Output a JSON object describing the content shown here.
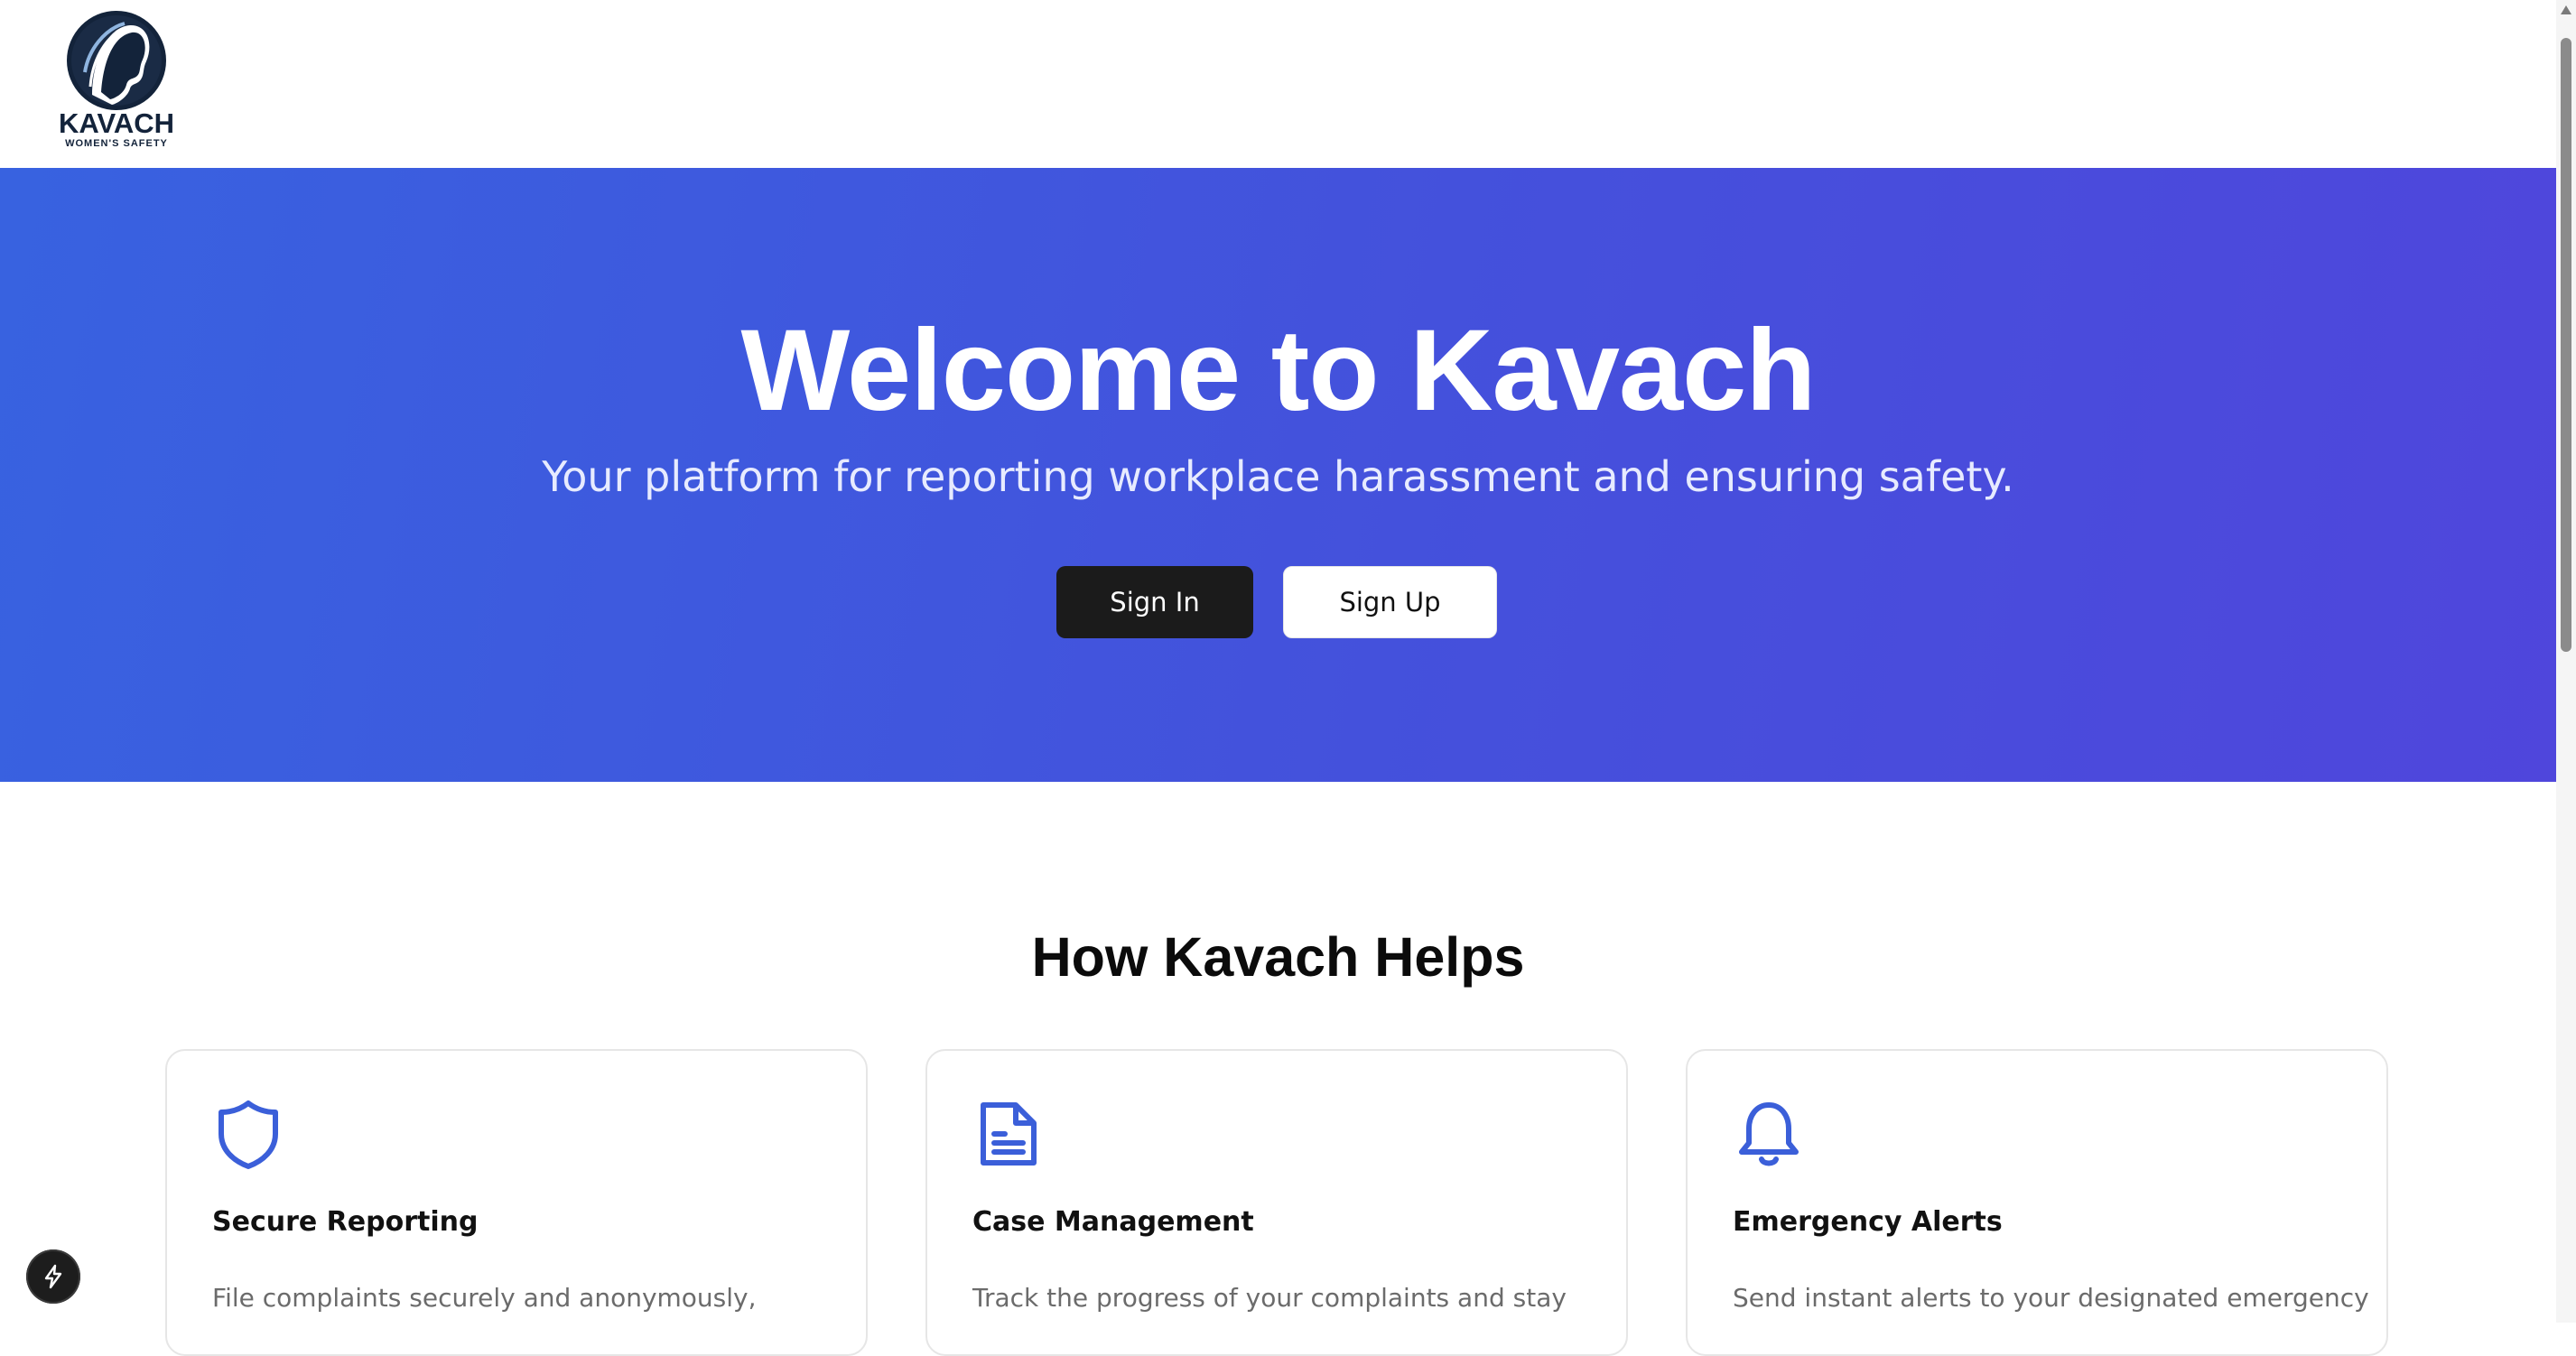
{
  "header": {
    "logo_word": "KAVACH",
    "logo_sub": "WOMEN'S SAFETY"
  },
  "hero": {
    "title": "Welcome to Kavach",
    "subtitle": "Your platform for reporting workplace harassment and ensuring safety.",
    "sign_in_label": "Sign In",
    "sign_up_label": "Sign Up"
  },
  "features": {
    "title": "How Kavach Helps",
    "cards": [
      {
        "icon": "shield-icon",
        "title": "Secure Reporting",
        "desc": "File complaints securely and anonymously,"
      },
      {
        "icon": "document-icon",
        "title": "Case Management",
        "desc": "Track the progress of your complaints and stay"
      },
      {
        "icon": "bell-icon",
        "title": "Emergency Alerts",
        "desc": "Send instant alerts to your designated emergency"
      }
    ]
  },
  "colors": {
    "hero_start": "#3862e0",
    "hero_end": "#4f46dc",
    "icon_blue": "#3b5fd9",
    "dark_button": "#1b1b1b"
  },
  "floating_button": {
    "icon": "lightning-icon"
  }
}
